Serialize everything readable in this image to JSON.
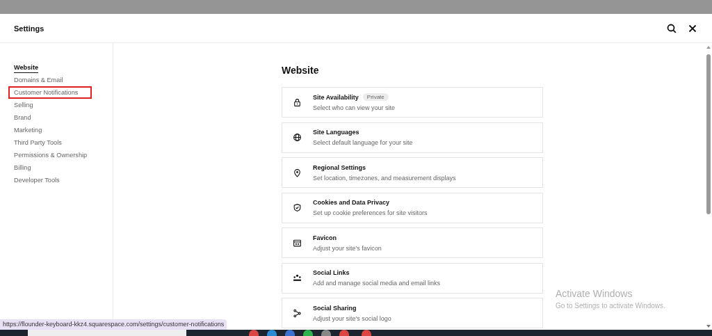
{
  "window": {
    "title": "Settings"
  },
  "sidebar": {
    "items": [
      {
        "label": "Website",
        "selected": true,
        "highlighted": false
      },
      {
        "label": "Domains & Email",
        "selected": false,
        "highlighted": false
      },
      {
        "label": "Customer Notifications",
        "selected": false,
        "highlighted": true
      },
      {
        "label": "Selling",
        "selected": false,
        "highlighted": false
      },
      {
        "label": "Brand",
        "selected": false,
        "highlighted": false
      },
      {
        "label": "Marketing",
        "selected": false,
        "highlighted": false
      },
      {
        "label": "Third Party Tools",
        "selected": false,
        "highlighted": false
      },
      {
        "label": "Permissions & Ownership",
        "selected": false,
        "highlighted": false
      },
      {
        "label": "Billing",
        "selected": false,
        "highlighted": false
      },
      {
        "label": "Developer Tools",
        "selected": false,
        "highlighted": false
      }
    ]
  },
  "content": {
    "heading": "Website",
    "cards": [
      {
        "kind": "lock",
        "title": "Site Availability",
        "badge": "Private",
        "description": "Select who can view your site"
      },
      {
        "kind": "globe",
        "title": "Site Languages",
        "description": "Select default language for your site"
      },
      {
        "kind": "pin",
        "title": "Regional Settings",
        "description": "Set location, timezones, and measurement displays"
      },
      {
        "kind": "shield",
        "title": "Cookies and Data Privacy",
        "description": "Set up cookie preferences for site visitors"
      },
      {
        "kind": "browser",
        "title": "Favicon",
        "description": "Adjust your site's favicon"
      },
      {
        "kind": "people",
        "title": "Social Links",
        "description": "Add and manage social media and email links"
      },
      {
        "kind": "share",
        "title": "Social Sharing",
        "description": "Adjust your site's social logo"
      }
    ]
  },
  "status_url": "https://flounder-keyboard-kkz4.squarespace.com/settings/customer-notifications",
  "activation_notice": {
    "title": "Activate Windows",
    "subtitle": "Go to Settings to activate Windows."
  }
}
